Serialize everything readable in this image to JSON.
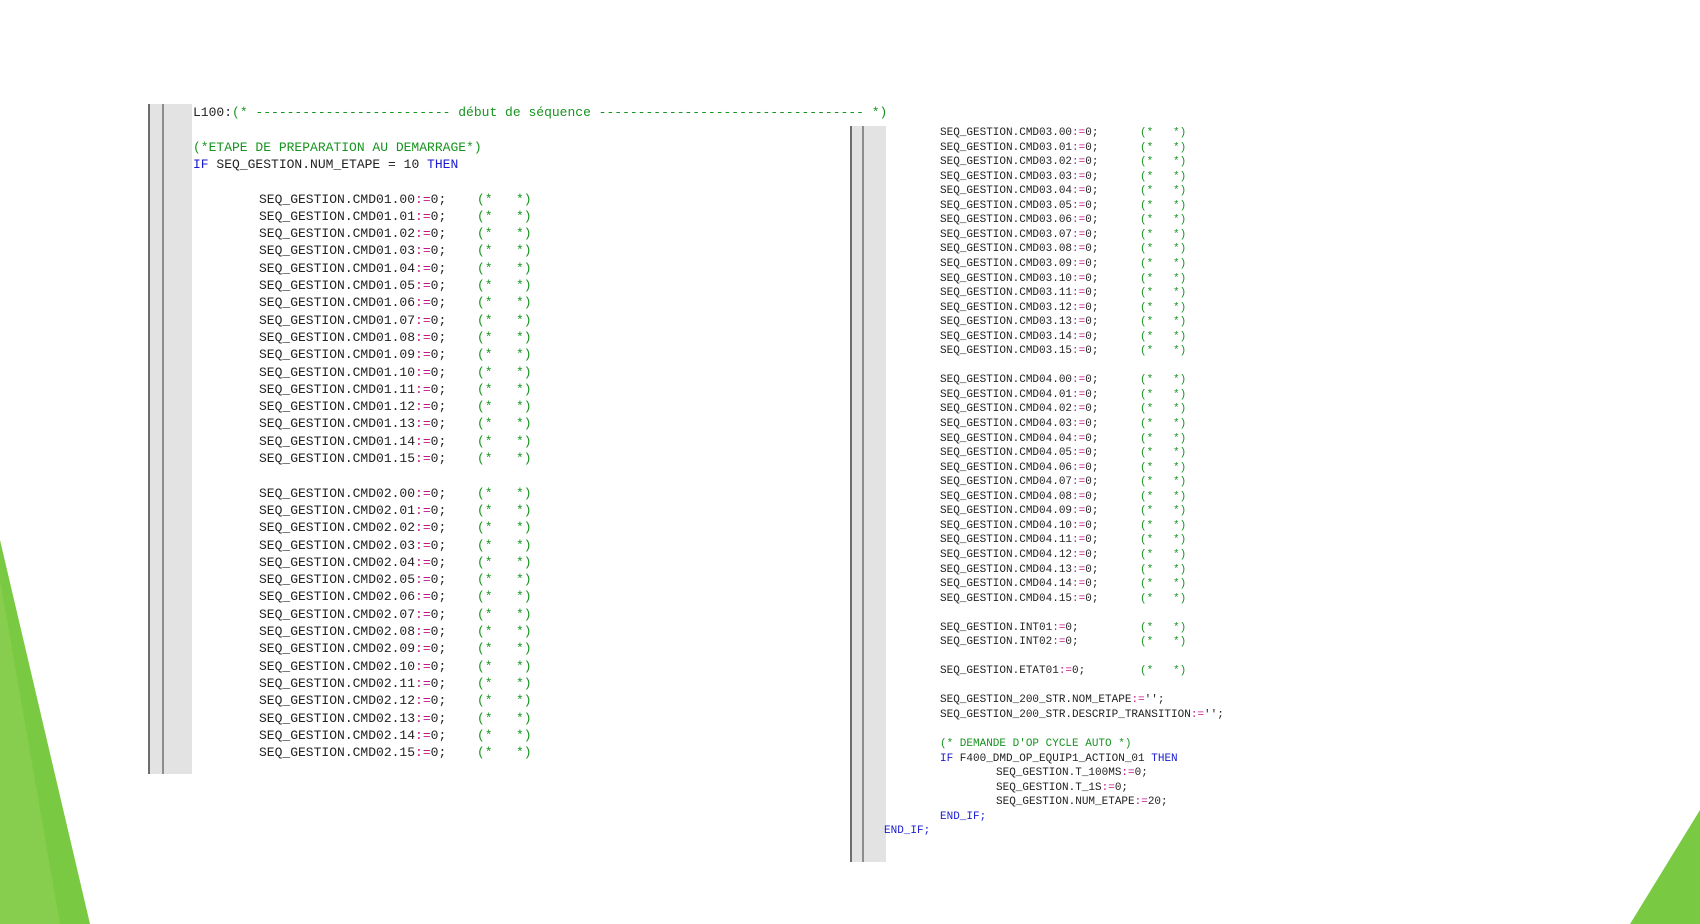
{
  "left_panel": {
    "lines": [
      {
        "t": "label",
        "text": "L100:",
        "comment": "(* ------------------------- début de séquence ---------------------------------- *)"
      },
      {
        "t": "blank"
      },
      {
        "t": "comment",
        "text": "(*ETAPE DE PREPARATION AU DEMARRAGE*)"
      },
      {
        "t": "if",
        "kw1": "IF",
        "expr": " SEQ_GESTION.NUM_ETAPE = 10 ",
        "kw2": "THEN"
      },
      {
        "t": "blank"
      },
      {
        "t": "assign",
        "var": "SEQ_GESTION.CMD01.00",
        "op": ":=",
        "val": "0;",
        "cm": "(*   *)"
      },
      {
        "t": "assign",
        "var": "SEQ_GESTION.CMD01.01",
        "op": ":=",
        "val": "0;",
        "cm": "(*   *)"
      },
      {
        "t": "assign",
        "var": "SEQ_GESTION.CMD01.02",
        "op": ":=",
        "val": "0;",
        "cm": "(*   *)"
      },
      {
        "t": "assign",
        "var": "SEQ_GESTION.CMD01.03",
        "op": ":=",
        "val": "0;",
        "cm": "(*   *)"
      },
      {
        "t": "assign",
        "var": "SEQ_GESTION.CMD01.04",
        "op": ":=",
        "val": "0;",
        "cm": "(*   *)"
      },
      {
        "t": "assign",
        "var": "SEQ_GESTION.CMD01.05",
        "op": ":=",
        "val": "0;",
        "cm": "(*   *)"
      },
      {
        "t": "assign",
        "var": "SEQ_GESTION.CMD01.06",
        "op": ":=",
        "val": "0;",
        "cm": "(*   *)"
      },
      {
        "t": "assign",
        "var": "SEQ_GESTION.CMD01.07",
        "op": ":=",
        "val": "0;",
        "cm": "(*   *)"
      },
      {
        "t": "assign",
        "var": "SEQ_GESTION.CMD01.08",
        "op": ":=",
        "val": "0;",
        "cm": "(*   *)"
      },
      {
        "t": "assign",
        "var": "SEQ_GESTION.CMD01.09",
        "op": ":=",
        "val": "0;",
        "cm": "(*   *)"
      },
      {
        "t": "assign",
        "var": "SEQ_GESTION.CMD01.10",
        "op": ":=",
        "val": "0;",
        "cm": "(*   *)"
      },
      {
        "t": "assign",
        "var": "SEQ_GESTION.CMD01.11",
        "op": ":=",
        "val": "0;",
        "cm": "(*   *)"
      },
      {
        "t": "assign",
        "var": "SEQ_GESTION.CMD01.12",
        "op": ":=",
        "val": "0;",
        "cm": "(*   *)"
      },
      {
        "t": "assign",
        "var": "SEQ_GESTION.CMD01.13",
        "op": ":=",
        "val": "0;",
        "cm": "(*   *)"
      },
      {
        "t": "assign",
        "var": "SEQ_GESTION.CMD01.14",
        "op": ":=",
        "val": "0;",
        "cm": "(*   *)"
      },
      {
        "t": "assign",
        "var": "SEQ_GESTION.CMD01.15",
        "op": ":=",
        "val": "0;",
        "cm": "(*   *)"
      },
      {
        "t": "blank"
      },
      {
        "t": "assign",
        "var": "SEQ_GESTION.CMD02.00",
        "op": ":=",
        "val": "0;",
        "cm": "(*   *)"
      },
      {
        "t": "assign",
        "var": "SEQ_GESTION.CMD02.01",
        "op": ":=",
        "val": "0;",
        "cm": "(*   *)"
      },
      {
        "t": "assign",
        "var": "SEQ_GESTION.CMD02.02",
        "op": ":=",
        "val": "0;",
        "cm": "(*   *)"
      },
      {
        "t": "assign",
        "var": "SEQ_GESTION.CMD02.03",
        "op": ":=",
        "val": "0;",
        "cm": "(*   *)"
      },
      {
        "t": "assign",
        "var": "SEQ_GESTION.CMD02.04",
        "op": ":=",
        "val": "0;",
        "cm": "(*   *)"
      },
      {
        "t": "assign",
        "var": "SEQ_GESTION.CMD02.05",
        "op": ":=",
        "val": "0;",
        "cm": "(*   *)"
      },
      {
        "t": "assign",
        "var": "SEQ_GESTION.CMD02.06",
        "op": ":=",
        "val": "0;",
        "cm": "(*   *)"
      },
      {
        "t": "assign",
        "var": "SEQ_GESTION.CMD02.07",
        "op": ":=",
        "val": "0;",
        "cm": "(*   *)"
      },
      {
        "t": "assign",
        "var": "SEQ_GESTION.CMD02.08",
        "op": ":=",
        "val": "0;",
        "cm": "(*   *)"
      },
      {
        "t": "assign",
        "var": "SEQ_GESTION.CMD02.09",
        "op": ":=",
        "val": "0;",
        "cm": "(*   *)"
      },
      {
        "t": "assign",
        "var": "SEQ_GESTION.CMD02.10",
        "op": ":=",
        "val": "0;",
        "cm": "(*   *)"
      },
      {
        "t": "assign",
        "var": "SEQ_GESTION.CMD02.11",
        "op": ":=",
        "val": "0;",
        "cm": "(*   *)"
      },
      {
        "t": "assign",
        "var": "SEQ_GESTION.CMD02.12",
        "op": ":=",
        "val": "0;",
        "cm": "(*   *)"
      },
      {
        "t": "assign",
        "var": "SEQ_GESTION.CMD02.13",
        "op": ":=",
        "val": "0;",
        "cm": "(*   *)"
      },
      {
        "t": "assign",
        "var": "SEQ_GESTION.CMD02.14",
        "op": ":=",
        "val": "0;",
        "cm": "(*   *)"
      },
      {
        "t": "assign",
        "var": "SEQ_GESTION.CMD02.15",
        "op": ":=",
        "val": "0;",
        "cm": "(*   *)"
      }
    ]
  },
  "right_panel": {
    "lines": [
      {
        "t": "assign",
        "var": "SEQ_GESTION.CMD03.00",
        "op": ":=",
        "val": "0;",
        "cm": "(*   *)"
      },
      {
        "t": "assign",
        "var": "SEQ_GESTION.CMD03.01",
        "op": ":=",
        "val": "0;",
        "cm": "(*   *)"
      },
      {
        "t": "assign",
        "var": "SEQ_GESTION.CMD03.02",
        "op": ":=",
        "val": "0;",
        "cm": "(*   *)"
      },
      {
        "t": "assign",
        "var": "SEQ_GESTION.CMD03.03",
        "op": ":=",
        "val": "0;",
        "cm": "(*   *)"
      },
      {
        "t": "assign",
        "var": "SEQ_GESTION.CMD03.04",
        "op": ":=",
        "val": "0;",
        "cm": "(*   *)"
      },
      {
        "t": "assign",
        "var": "SEQ_GESTION.CMD03.05",
        "op": ":=",
        "val": "0;",
        "cm": "(*   *)"
      },
      {
        "t": "assign",
        "var": "SEQ_GESTION.CMD03.06",
        "op": ":=",
        "val": "0;",
        "cm": "(*   *)"
      },
      {
        "t": "assign",
        "var": "SEQ_GESTION.CMD03.07",
        "op": ":=",
        "val": "0;",
        "cm": "(*   *)"
      },
      {
        "t": "assign",
        "var": "SEQ_GESTION.CMD03.08",
        "op": ":=",
        "val": "0;",
        "cm": "(*   *)"
      },
      {
        "t": "assign",
        "var": "SEQ_GESTION.CMD03.09",
        "op": ":=",
        "val": "0;",
        "cm": "(*   *)"
      },
      {
        "t": "assign",
        "var": "SEQ_GESTION.CMD03.10",
        "op": ":=",
        "val": "0;",
        "cm": "(*   *)"
      },
      {
        "t": "assign",
        "var": "SEQ_GESTION.CMD03.11",
        "op": ":=",
        "val": "0;",
        "cm": "(*   *)"
      },
      {
        "t": "assign",
        "var": "SEQ_GESTION.CMD03.12",
        "op": ":=",
        "val": "0;",
        "cm": "(*   *)"
      },
      {
        "t": "assign",
        "var": "SEQ_GESTION.CMD03.13",
        "op": ":=",
        "val": "0;",
        "cm": "(*   *)"
      },
      {
        "t": "assign",
        "var": "SEQ_GESTION.CMD03.14",
        "op": ":=",
        "val": "0;",
        "cm": "(*   *)"
      },
      {
        "t": "assign",
        "var": "SEQ_GESTION.CMD03.15",
        "op": ":=",
        "val": "0;",
        "cm": "(*   *)"
      },
      {
        "t": "blank"
      },
      {
        "t": "assign",
        "var": "SEQ_GESTION.CMD04.00",
        "op": ":=",
        "val": "0;",
        "cm": "(*   *)"
      },
      {
        "t": "assign",
        "var": "SEQ_GESTION.CMD04.01",
        "op": ":=",
        "val": "0;",
        "cm": "(*   *)"
      },
      {
        "t": "assign",
        "var": "SEQ_GESTION.CMD04.02",
        "op": ":=",
        "val": "0;",
        "cm": "(*   *)"
      },
      {
        "t": "assign",
        "var": "SEQ_GESTION.CMD04.03",
        "op": ":=",
        "val": "0;",
        "cm": "(*   *)"
      },
      {
        "t": "assign",
        "var": "SEQ_GESTION.CMD04.04",
        "op": ":=",
        "val": "0;",
        "cm": "(*   *)"
      },
      {
        "t": "assign",
        "var": "SEQ_GESTION.CMD04.05",
        "op": ":=",
        "val": "0;",
        "cm": "(*   *)"
      },
      {
        "t": "assign",
        "var": "SEQ_GESTION.CMD04.06",
        "op": ":=",
        "val": "0;",
        "cm": "(*   *)"
      },
      {
        "t": "assign",
        "var": "SEQ_GESTION.CMD04.07",
        "op": ":=",
        "val": "0;",
        "cm": "(*   *)"
      },
      {
        "t": "assign",
        "var": "SEQ_GESTION.CMD04.08",
        "op": ":=",
        "val": "0;",
        "cm": "(*   *)"
      },
      {
        "t": "assign",
        "var": "SEQ_GESTION.CMD04.09",
        "op": ":=",
        "val": "0;",
        "cm": "(*   *)"
      },
      {
        "t": "assign",
        "var": "SEQ_GESTION.CMD04.10",
        "op": ":=",
        "val": "0;",
        "cm": "(*   *)"
      },
      {
        "t": "assign",
        "var": "SEQ_GESTION.CMD04.11",
        "op": ":=",
        "val": "0;",
        "cm": "(*   *)"
      },
      {
        "t": "assign",
        "var": "SEQ_GESTION.CMD04.12",
        "op": ":=",
        "val": "0;",
        "cm": "(*   *)"
      },
      {
        "t": "assign",
        "var": "SEQ_GESTION.CMD04.13",
        "op": ":=",
        "val": "0;",
        "cm": "(*   *)"
      },
      {
        "t": "assign",
        "var": "SEQ_GESTION.CMD04.14",
        "op": ":=",
        "val": "0;",
        "cm": "(*   *)"
      },
      {
        "t": "assign",
        "var": "SEQ_GESTION.CMD04.15",
        "op": ":=",
        "val": "0;",
        "cm": "(*   *)"
      },
      {
        "t": "blank"
      },
      {
        "t": "assign",
        "var": "SEQ_GESTION.INT01",
        "op": ":=",
        "val": "0;",
        "cm": "(*   *)"
      },
      {
        "t": "assign",
        "var": "SEQ_GESTION.INT02",
        "op": ":=",
        "val": "0;",
        "cm": "(*   *)"
      },
      {
        "t": "blank"
      },
      {
        "t": "assign",
        "var": "SEQ_GESTION.ETAT01",
        "op": ":=",
        "val": "0;",
        "cm": "(*   *)"
      },
      {
        "t": "blank"
      },
      {
        "t": "assign",
        "var": "SEQ_GESTION_200_STR.NOM_ETAPE",
        "op": ":=",
        "val": "'';",
        "cm": ""
      },
      {
        "t": "assign",
        "var": "SEQ_GESTION_200_STR.DESCRIP_TRANSITION",
        "op": ":=",
        "val": "'';",
        "cm": ""
      },
      {
        "t": "blank"
      },
      {
        "t": "comment",
        "text": "(* DEMANDE D'OP CYCLE AUTO *)"
      },
      {
        "t": "if",
        "kw1": "IF",
        "expr": " F400_DMD_OP_EQUIP1_ACTION_01 ",
        "kw2": "THEN"
      },
      {
        "t": "assign",
        "indent": 2,
        "var": "SEQ_GESTION.T_100MS",
        "op": ":=",
        "val": "0;",
        "cm": ""
      },
      {
        "t": "assign",
        "indent": 2,
        "var": "SEQ_GESTION.T_1S",
        "op": ":=",
        "val": "0;",
        "cm": ""
      },
      {
        "t": "assign",
        "indent": 2,
        "var": "SEQ_GESTION.NUM_ETAPE",
        "op": ":=",
        "val": "20;",
        "cm": ""
      },
      {
        "t": "end",
        "text": "END_IF;"
      },
      {
        "t": "end",
        "outdent": true,
        "text": "END_IF;"
      }
    ]
  },
  "colors": {
    "green_accent": "#7ac943",
    "keyword": "#1a1ad0",
    "operator": "#c2148a",
    "comment": "#17941f"
  }
}
